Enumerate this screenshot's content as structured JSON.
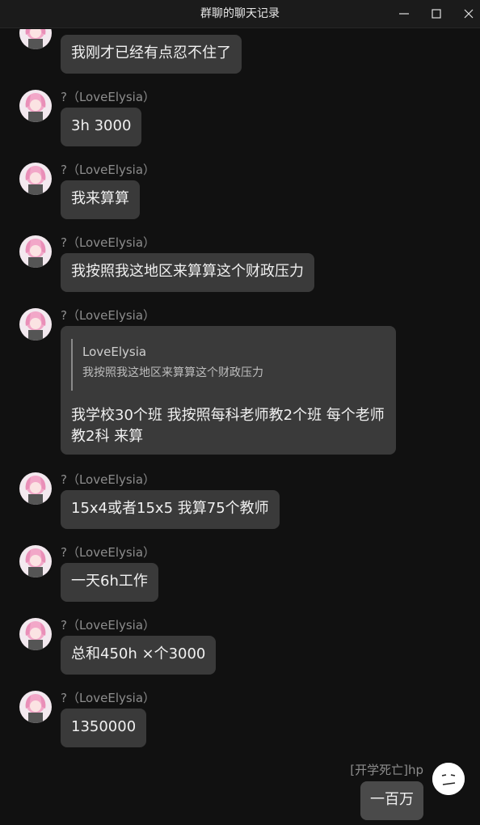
{
  "window": {
    "title": "群聊的聊天记录",
    "icons": {
      "minimize": "minimize-icon",
      "maximize": "maximize-icon",
      "close": "close-icon"
    }
  },
  "messages": [
    {
      "sender": "",
      "text": "我刚才已经有点忍不住了"
    },
    {
      "sender": "?（LoveElysia）",
      "text": "3h 3000"
    },
    {
      "sender": "?（LoveElysia）",
      "text": "我来算算"
    },
    {
      "sender": "?（LoveElysia）",
      "text": "我按照我这地区来算算这个财政压力"
    },
    {
      "sender": "?（LoveElysia）",
      "quote": {
        "author": "LoveElysia",
        "text": "我按照我这地区来算算这个财政压力"
      },
      "text_line1": "我学校30个班 我按照每科老师教2个班 每个老师",
      "text_line2": "教2科 来算"
    },
    {
      "sender": "?（LoveElysia）",
      "text": "15x4或者15x5 我算75个教师"
    },
    {
      "sender": "?（LoveElysia）",
      "text": "一天6h工作"
    },
    {
      "sender": "?（LoveElysia）",
      "text": "总和450h ×个3000"
    },
    {
      "sender": "?（LoveElysia）",
      "text": "1350000"
    }
  ],
  "self_message": {
    "sender": "[开学死亡]hp",
    "text": "一百万"
  },
  "colors": {
    "background": "#111111",
    "bubble": "#3a3a3a",
    "self_bubble": "#4a4a4a",
    "sender": "#8d8d8d"
  }
}
